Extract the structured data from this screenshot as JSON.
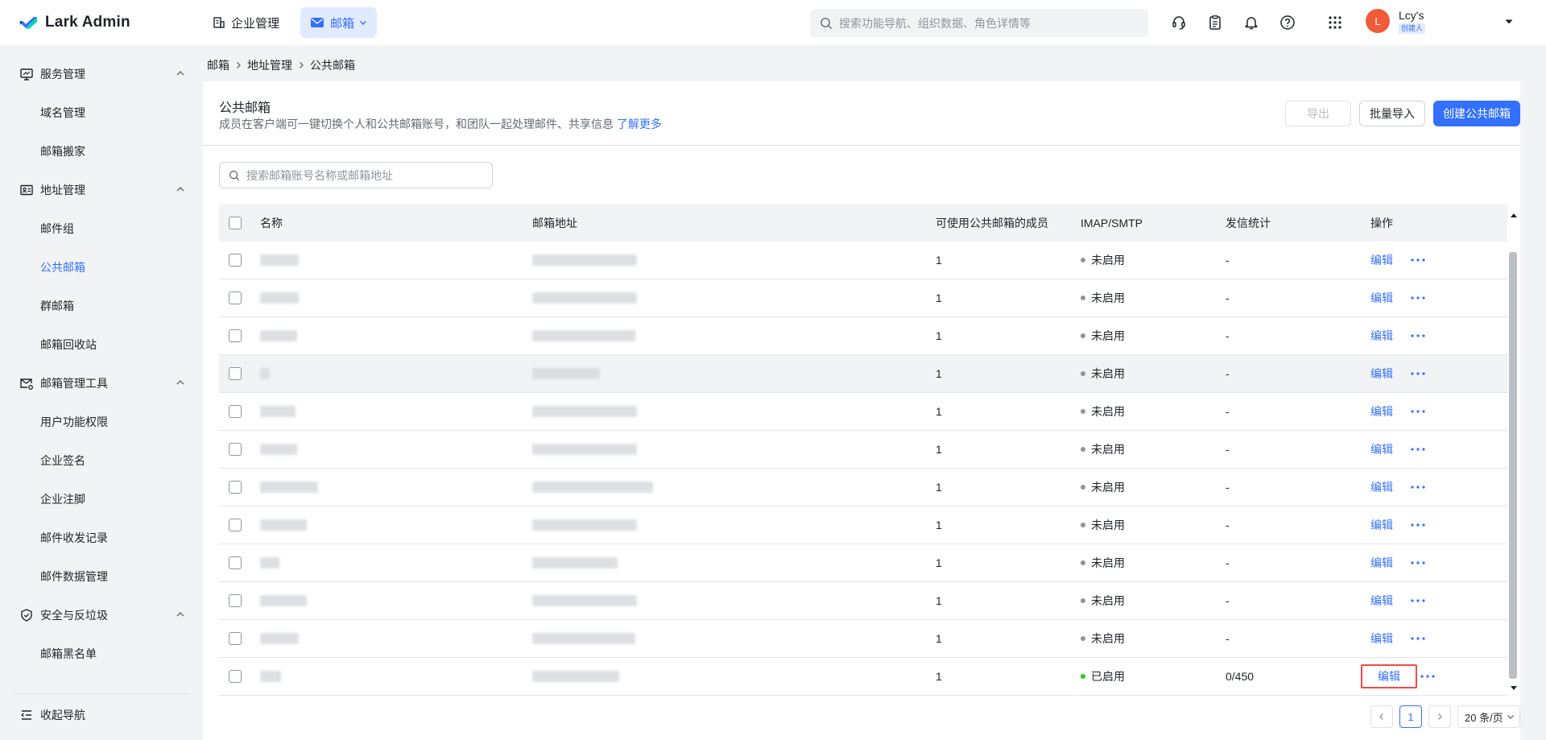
{
  "brand": {
    "name": "Lark Admin"
  },
  "top_nav": [
    {
      "label": "企业管理",
      "icon": "building-icon",
      "active": false
    },
    {
      "label": "邮箱",
      "icon": "mail-icon",
      "active": true,
      "has_dropdown": true
    }
  ],
  "top_search": {
    "placeholder": "搜索功能导航、组织数据、角色详情等"
  },
  "top_icons": [
    "headset-icon",
    "clipboard-icon",
    "bell-icon",
    "help-icon",
    "apps-grid-icon"
  ],
  "user": {
    "avatar_letter": "L",
    "name": "Lcy's",
    "badge": "创建人"
  },
  "sidebar": {
    "groups": [
      {
        "label": "服务管理",
        "icon": "monitor-icon",
        "items": [
          "域名管理",
          "邮箱搬家"
        ]
      },
      {
        "label": "地址管理",
        "icon": "id-card-icon",
        "items": [
          "邮件组",
          "公共邮箱",
          "群邮箱",
          "邮箱回收站"
        ]
      },
      {
        "label": "邮箱管理工具",
        "icon": "mail-settings-icon",
        "items": [
          "用户功能权限",
          "企业签名",
          "企业注脚",
          "邮件收发记录",
          "邮件数据管理"
        ]
      },
      {
        "label": "安全与反垃圾",
        "icon": "shield-icon",
        "items": [
          "邮箱黑名单"
        ]
      }
    ],
    "active_item": "公共邮箱",
    "collapse_label": "收起导航"
  },
  "breadcrumb": [
    "邮箱",
    "地址管理",
    "公共邮箱"
  ],
  "page": {
    "title": "公共邮箱",
    "description": "成员在客户端可一键切换个人和公共邮箱账号，和团队一起处理邮件、共享信息",
    "learn_more": "了解更多",
    "buttons": {
      "export": "导出",
      "import": "批量导入",
      "create": "创建公共邮箱"
    },
    "search_placeholder": "搜索邮箱账号名称或邮箱地址"
  },
  "table": {
    "columns": {
      "name": "名称",
      "address": "邮箱地址",
      "members": "可使用公共邮箱的成员",
      "imap": "IMAP/SMTP",
      "stats": "发信统计",
      "ops": "操作"
    },
    "edit_label": "编辑",
    "rows": [
      {
        "members": "1",
        "imap": "未启用",
        "imap_on": false,
        "stats": "-"
      },
      {
        "members": "1",
        "imap": "未启用",
        "imap_on": false,
        "stats": "-"
      },
      {
        "members": "1",
        "imap": "未启用",
        "imap_on": false,
        "stats": "-"
      },
      {
        "members": "1",
        "imap": "未启用",
        "imap_on": false,
        "stats": "-"
      },
      {
        "members": "1",
        "imap": "未启用",
        "imap_on": false,
        "stats": "-"
      },
      {
        "members": "1",
        "imap": "未启用",
        "imap_on": false,
        "stats": "-"
      },
      {
        "members": "1",
        "imap": "未启用",
        "imap_on": false,
        "stats": "-"
      },
      {
        "members": "1",
        "imap": "未启用",
        "imap_on": false,
        "stats": "-"
      },
      {
        "members": "1",
        "imap": "未启用",
        "imap_on": false,
        "stats": "-"
      },
      {
        "members": "1",
        "imap": "未启用",
        "imap_on": false,
        "stats": "-"
      },
      {
        "members": "1",
        "imap": "未启用",
        "imap_on": false,
        "stats": "-"
      },
      {
        "members": "1",
        "imap": "已启用",
        "imap_on": true,
        "stats": "0/450"
      }
    ]
  },
  "pagination": {
    "current": "1",
    "page_size": "20 条/页"
  },
  "colors": {
    "accent": "#3370ff",
    "highlight": "#f54a45",
    "status_on": "#34c724",
    "status_off": "#8f959e"
  }
}
